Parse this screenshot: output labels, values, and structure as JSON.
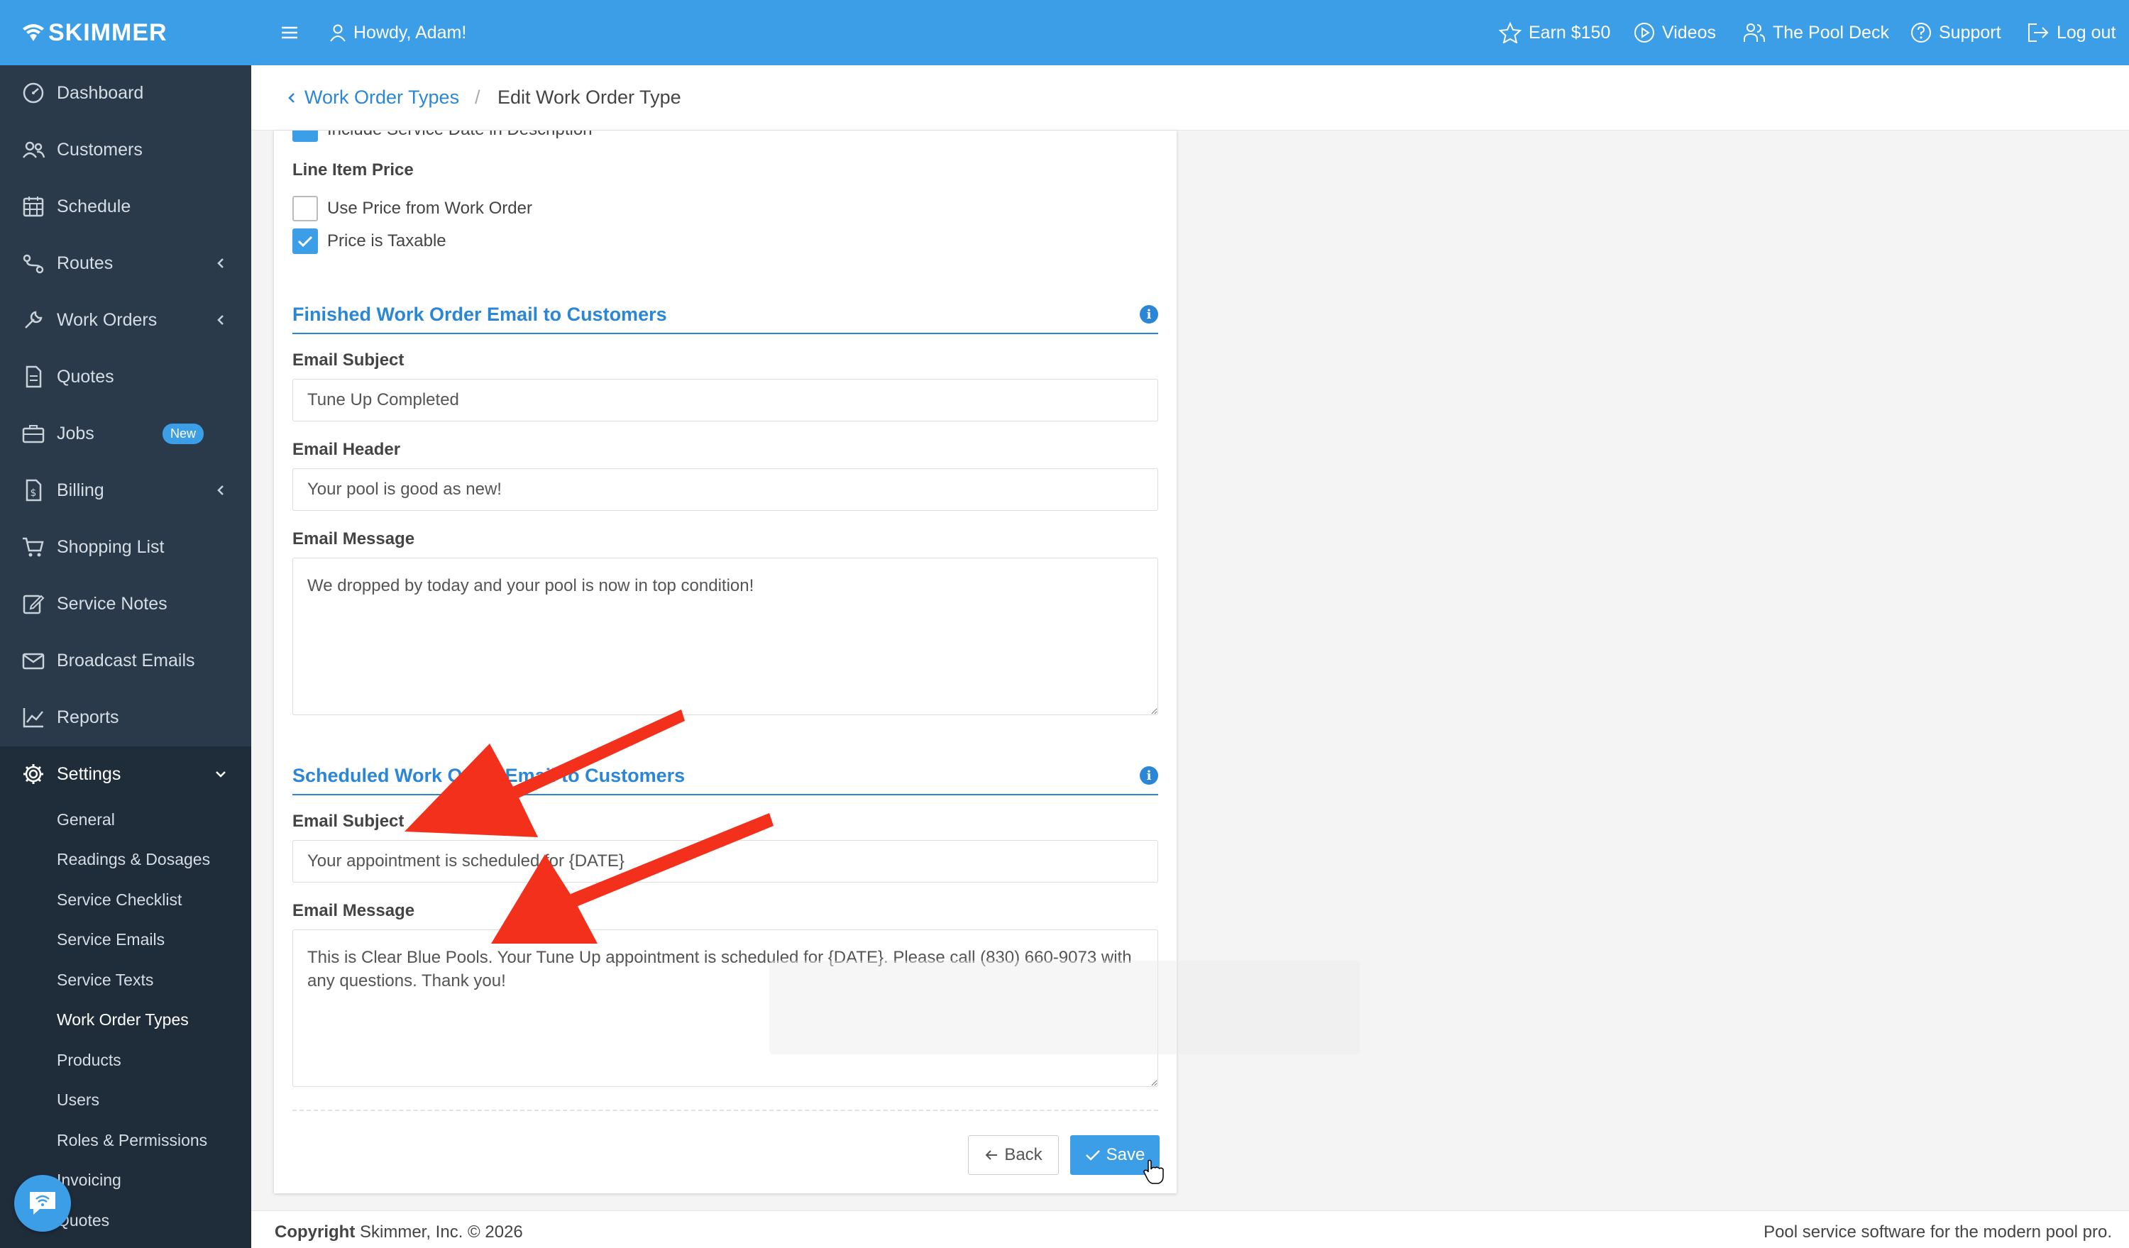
{
  "app": {
    "logo_text": "SKIMMER"
  },
  "sidebar": {
    "items": [
      {
        "label": "Dashboard",
        "icon": "dashboard-icon"
      },
      {
        "label": "Customers",
        "icon": "users-icon"
      },
      {
        "label": "Schedule",
        "icon": "calendar-icon"
      },
      {
        "label": "Routes",
        "icon": "route-icon",
        "has_children": true
      },
      {
        "label": "Work Orders",
        "icon": "wrench-icon",
        "has_children": true
      },
      {
        "label": "Quotes",
        "icon": "document-icon"
      },
      {
        "label": "Jobs",
        "icon": "briefcase-icon",
        "badge": "New"
      },
      {
        "label": "Billing",
        "icon": "invoice-icon",
        "has_children": true
      },
      {
        "label": "Shopping List",
        "icon": "cart-icon"
      },
      {
        "label": "Service Notes",
        "icon": "edit-note-icon"
      },
      {
        "label": "Broadcast Emails",
        "icon": "mail-icon"
      },
      {
        "label": "Reports",
        "icon": "chart-line-icon"
      },
      {
        "label": "Settings",
        "icon": "gear-icon",
        "expanded": true
      }
    ],
    "settings_children": [
      "General",
      "Readings & Dosages",
      "Service Checklist",
      "Service Emails",
      "Service Texts",
      "Work Order Types",
      "Products",
      "Users",
      "Roles & Permissions",
      "Invoicing",
      "Quotes"
    ],
    "current_child": "Work Order Types"
  },
  "topbar": {
    "greeting": "Howdy, Adam!",
    "links": [
      {
        "label": "Earn $150",
        "icon": "star-icon"
      },
      {
        "label": "Videos",
        "icon": "play-circle-icon"
      },
      {
        "label": "The Pool Deck",
        "icon": "community-icon"
      },
      {
        "label": "Support",
        "icon": "help-circle-icon"
      },
      {
        "label": "Log out",
        "icon": "logout-icon"
      }
    ]
  },
  "breadcrumb": {
    "parent": "Work Order Types",
    "separator": "/",
    "current": "Edit Work Order Type"
  },
  "form": {
    "partial_checkbox_label": "Include Service Date in Description",
    "line_item_price_label": "Line Item Price",
    "use_price_label": "Use Price from Work Order",
    "use_price_checked": false,
    "taxable_label": "Price is Taxable",
    "taxable_checked": true,
    "finished_section": {
      "title": "Finished Work Order Email to Customers",
      "subject_label": "Email Subject",
      "subject_value": "Tune Up Completed",
      "header_label": "Email Header",
      "header_value": "Your pool is good as new!",
      "message_label": "Email Message",
      "message_value": "We dropped by today and your pool is now in top condition!"
    },
    "scheduled_section": {
      "title": "Scheduled Work Order Email to Customers",
      "subject_label": "Email Subject",
      "subject_value": "Your appointment is scheduled for {DATE}",
      "message_label": "Email Message",
      "message_value": "This is Clear Blue Pools. Your Tune Up appointment is scheduled for {DATE}. Please call (830) 660-9073 with any questions. Thank you!"
    },
    "back_label": "Back",
    "save_label": "Save"
  },
  "footer": {
    "copyright_bold": "Copyright",
    "copyright_rest": " Skimmer, Inc. © 2026",
    "tagline": "Pool service software for the modern pool pro."
  },
  "colors": {
    "brand": "#3d9ee8",
    "sidebar": "#2a3a4b",
    "link": "#2b87d6",
    "annotation": "#f2301c"
  }
}
